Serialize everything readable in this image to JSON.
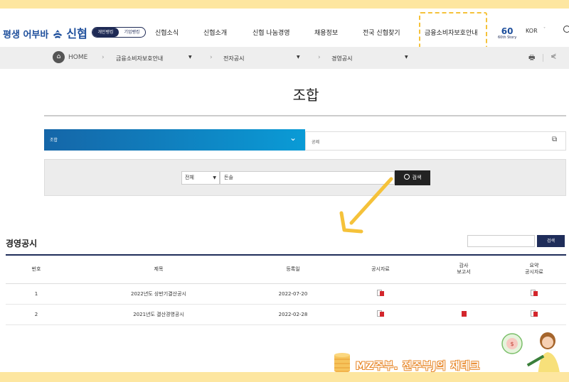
{
  "header": {
    "logo_prefix": "평생 어부바",
    "logo_name": "신협",
    "segment": [
      "개인뱅킹",
      "기업뱅킹"
    ],
    "nav": [
      "신협소식",
      "신협소개",
      "신협 나눔경영",
      "채용정보",
      "전국 신협찾기",
      "금융소비자보호안내"
    ],
    "story_num": "60",
    "story_label": "60th Story",
    "lang": "KOR"
  },
  "breadcrumb": {
    "home": "HOME",
    "items": [
      "금융소비자보호안내",
      "전자공시",
      "경영공시"
    ]
  },
  "page": {
    "title": "조합"
  },
  "tabs": {
    "active": "조합",
    "inactive": "공제"
  },
  "search": {
    "select_value": "전체",
    "keyword": "돈솔",
    "button": "검색"
  },
  "section": {
    "title": "경영공시",
    "search_button": "검색",
    "columns": [
      "번호",
      "제목",
      "등록일",
      "공시자료",
      "감사\n보고서",
      "요약\n공시자료"
    ],
    "rows": [
      {
        "num": "1",
        "title": "2022년도 상반기결산공시",
        "date": "2022-07-20",
        "disclosure": "doc",
        "audit": "",
        "summary": "doc"
      },
      {
        "num": "2",
        "title": "2021년도 결산경영공시",
        "date": "2022-02-28",
        "disclosure": "doc",
        "audit": "pdf",
        "summary": "doc"
      }
    ]
  },
  "watermark": "MZ주부. 전주부J의 재테크",
  "colors": {
    "brand": "#1e4f9c",
    "navy": "#1f2d5a",
    "tab_gradient_start": "#1566a8",
    "tab_gradient_end": "#0a9bd6",
    "highlight": "#f5c23a",
    "band": "#fde6a0"
  }
}
